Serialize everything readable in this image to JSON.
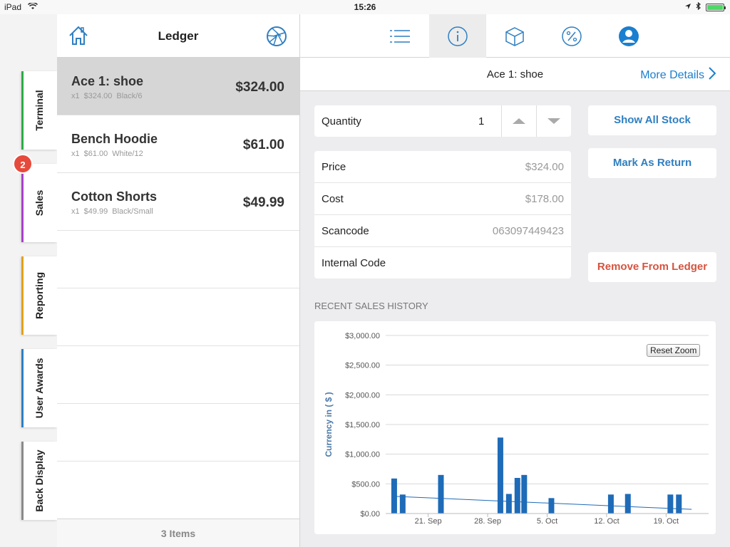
{
  "statusbar": {
    "device": "iPad",
    "time": "15:26"
  },
  "rail": {
    "tabs": [
      {
        "label": "Terminal",
        "color": "#2eab47"
      },
      {
        "label": "Sales",
        "color": "#a742c7"
      },
      {
        "label": "Reporting",
        "color": "#e0a11a"
      },
      {
        "label": "User Awards",
        "color": "#2f7fc1"
      },
      {
        "label": "Back Display",
        "color": "#8a8a8a"
      }
    ],
    "sales_badge": "2"
  },
  "ledger": {
    "title": "Ledger",
    "items": [
      {
        "name": "Ace 1: shoe",
        "qty": "x1",
        "unit_price": "$324.00",
        "variant": "Black/6",
        "price": "$324.00",
        "selected": true
      },
      {
        "name": "Bench Hoodie",
        "qty": "x1",
        "unit_price": "$61.00",
        "variant": "White/12",
        "price": "$61.00",
        "selected": false
      },
      {
        "name": "Cotton Shorts",
        "qty": "x1",
        "unit_price": "$49.99",
        "variant": "Black/Small",
        "price": "$49.99",
        "selected": false
      }
    ],
    "footer": "3 Items"
  },
  "toolbar": {
    "icons": [
      "list-icon",
      "info-icon",
      "box-icon",
      "percent-icon",
      "user-icon"
    ],
    "active": "info-icon"
  },
  "detail": {
    "title": "Ace 1: shoe",
    "more_details": "More Details",
    "quantity_label": "Quantity",
    "quantity_value": "1",
    "fields": [
      {
        "label": "Price",
        "value": "$324.00"
      },
      {
        "label": "Cost",
        "value": "$178.00"
      },
      {
        "label": "Scancode",
        "value": "063097449423"
      },
      {
        "label": "Internal Code",
        "value": ""
      }
    ],
    "buttons": {
      "show_all_stock": "Show All Stock",
      "mark_as_return": "Mark As Return",
      "remove_from_ledger": "Remove From Ledger"
    },
    "history_label": "RECENT SALES HISTORY",
    "reset_zoom": "Reset Zoom"
  },
  "chart_data": {
    "type": "bar",
    "title": "",
    "ylabel": "Currency in ( $ )",
    "ylim": [
      0,
      3000
    ],
    "yticks": [
      "$0.00",
      "$500.00",
      "$1,000.00",
      "$1,500.00",
      "$2,000.00",
      "$2,500.00",
      "$3,000.00"
    ],
    "xticks": [
      "21. Sep",
      "28. Sep",
      "5. Oct",
      "12. Oct",
      "19. Oct"
    ],
    "xrange_days": [
      16.5,
      41
    ],
    "xtick_days": [
      21,
      28,
      35,
      42,
      49
    ],
    "bars": [
      {
        "day": 17,
        "value": 590
      },
      {
        "day": 18,
        "value": 320
      },
      {
        "day": 22.5,
        "value": 650
      },
      {
        "day": 29.5,
        "value": 1280
      },
      {
        "day": 30.5,
        "value": 330
      },
      {
        "day": 31.5,
        "value": 600
      },
      {
        "day": 32.3,
        "value": 650
      },
      {
        "day": 35.5,
        "value": 260
      },
      {
        "day": 42.5,
        "value": 320
      },
      {
        "day": 44.5,
        "value": 330
      },
      {
        "day": 49.5,
        "value": 320
      },
      {
        "day": 50.5,
        "value": 320
      }
    ],
    "trendline": [
      {
        "day": 17,
        "value": 290
      },
      {
        "day": 52,
        "value": 70
      }
    ],
    "bar_color": "#1e6bb8",
    "grid": true
  }
}
